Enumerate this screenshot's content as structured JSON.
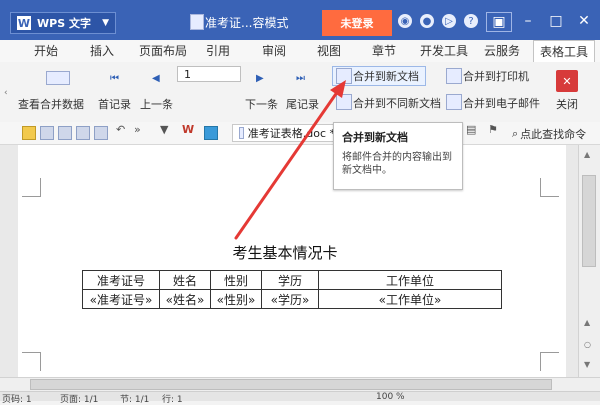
{
  "titlebar": {
    "app_name": "WPS 文字",
    "doc_title": "准考证...容模式",
    "login_label": "未登录"
  },
  "menu": {
    "tabs": [
      "开始",
      "插入",
      "页面布局",
      "引用",
      "审阅",
      "视图",
      "章节",
      "开发工具",
      "云服务",
      "表格工具"
    ]
  },
  "ribbon": {
    "view_merged": "查看合并数据",
    "first_record": "首记录",
    "prev": "上一条",
    "record_value": "1",
    "next": "下一条",
    "last_record": "尾记录",
    "merge_new_doc": "合并到新文档",
    "merge_diff_doc": "合并到不同新文档",
    "merge_printer": "合并到打印机",
    "merge_email": "合并到电子邮件",
    "close": "关闭"
  },
  "toolbar": {
    "doc_tab_name": "准考证表格.doc *",
    "search_label": "点此查找命令"
  },
  "tooltip": {
    "title": "合并到新文档",
    "desc": "将邮件合并的内容输出到新文档中。"
  },
  "document": {
    "heading": "考生基本情况卡",
    "table": {
      "headers": [
        "准考证号",
        "姓名",
        "性别",
        "学历",
        "工作单位"
      ],
      "row": [
        "«准考证号»",
        "«姓名»",
        "«性别»",
        "«学历»",
        "«工作单位»"
      ]
    }
  },
  "status": {
    "page_num": "页码: 1",
    "page_total": "页面: 1/1",
    "section": "节: 1/1",
    "line": "行: 1",
    "zoom": "100 %"
  },
  "colors": {
    "titlebar": "#3a63b6",
    "login": "#ff6b3f",
    "arrow": "#e53935"
  }
}
